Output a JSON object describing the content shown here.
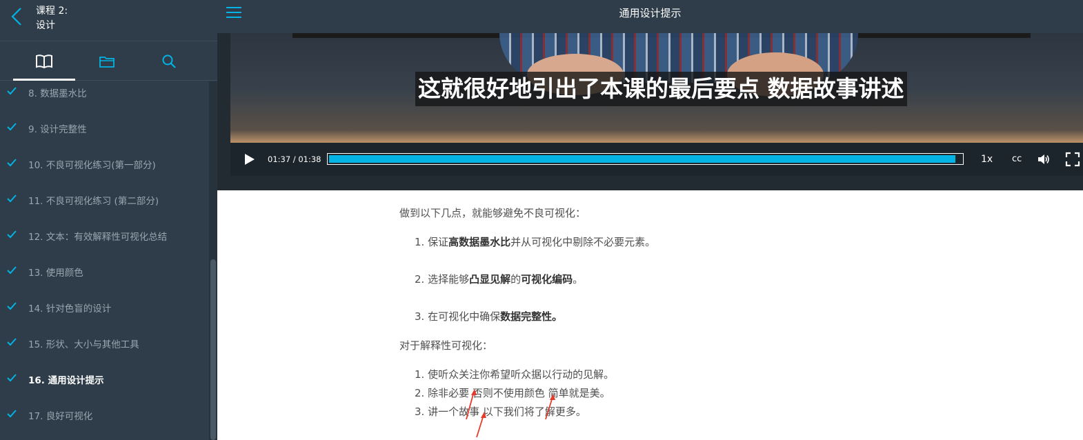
{
  "sidebar": {
    "course_line1": "课程 2:",
    "course_line2": "设计",
    "lessons": [
      {
        "label": "8. 数据墨水比",
        "active": false
      },
      {
        "label": "9. 设计完整性",
        "active": false
      },
      {
        "label": "10. 不良可视化练习(第一部分)",
        "active": false
      },
      {
        "label": "11. 不良可视化练习 (第二部分)",
        "active": false
      },
      {
        "label": "12. 文本：有效解释性可视化总结",
        "active": false
      },
      {
        "label": "13. 使用颜色",
        "active": false
      },
      {
        "label": "14. 针对色盲的设计",
        "active": false
      },
      {
        "label": "15. 形状、大小与其他工具",
        "active": false
      },
      {
        "label": "16. 通用设计提示",
        "active": true
      },
      {
        "label": "17. 良好可视化",
        "active": false
      }
    ]
  },
  "header": {
    "title": "通用设计提示"
  },
  "video": {
    "subtitle": "这就很好地引出了本课的最后要点 数据故事讲述",
    "time": "01:37 / 01:38",
    "progress_fraction": 0.99,
    "speed": "1x",
    "cc": "cc"
  },
  "content": {
    "intro": "做到以下几点，就能够避免不良可视化：",
    "list1": [
      {
        "prefix": "1. 保证",
        "b1": "高数据墨水比",
        "mid": "并从可视化中剔除不必要元素。",
        "b2": "",
        "suffix": ""
      },
      {
        "prefix": "2. 选择能够",
        "b1": "凸显见解",
        "mid": "的",
        "b2": "可视化编码",
        "suffix": "。"
      },
      {
        "prefix": "3. 在可视化中确保",
        "b1": "数据完整性。",
        "mid": "",
        "b2": "",
        "suffix": ""
      }
    ],
    "section2": "对于解释性可视化：",
    "list2": [
      "1. 使听众关注你希望听众据以行动的见解。",
      "2. 除非必要 否则不使用颜色 简单就是美。",
      "3. 讲一个故事 以下我们将了解更多。"
    ]
  },
  "colors": {
    "sidebar_bg": "#2e3d49",
    "accent": "#02b3e4",
    "check": "#02b3e4",
    "arrow": "#e53b2c"
  }
}
